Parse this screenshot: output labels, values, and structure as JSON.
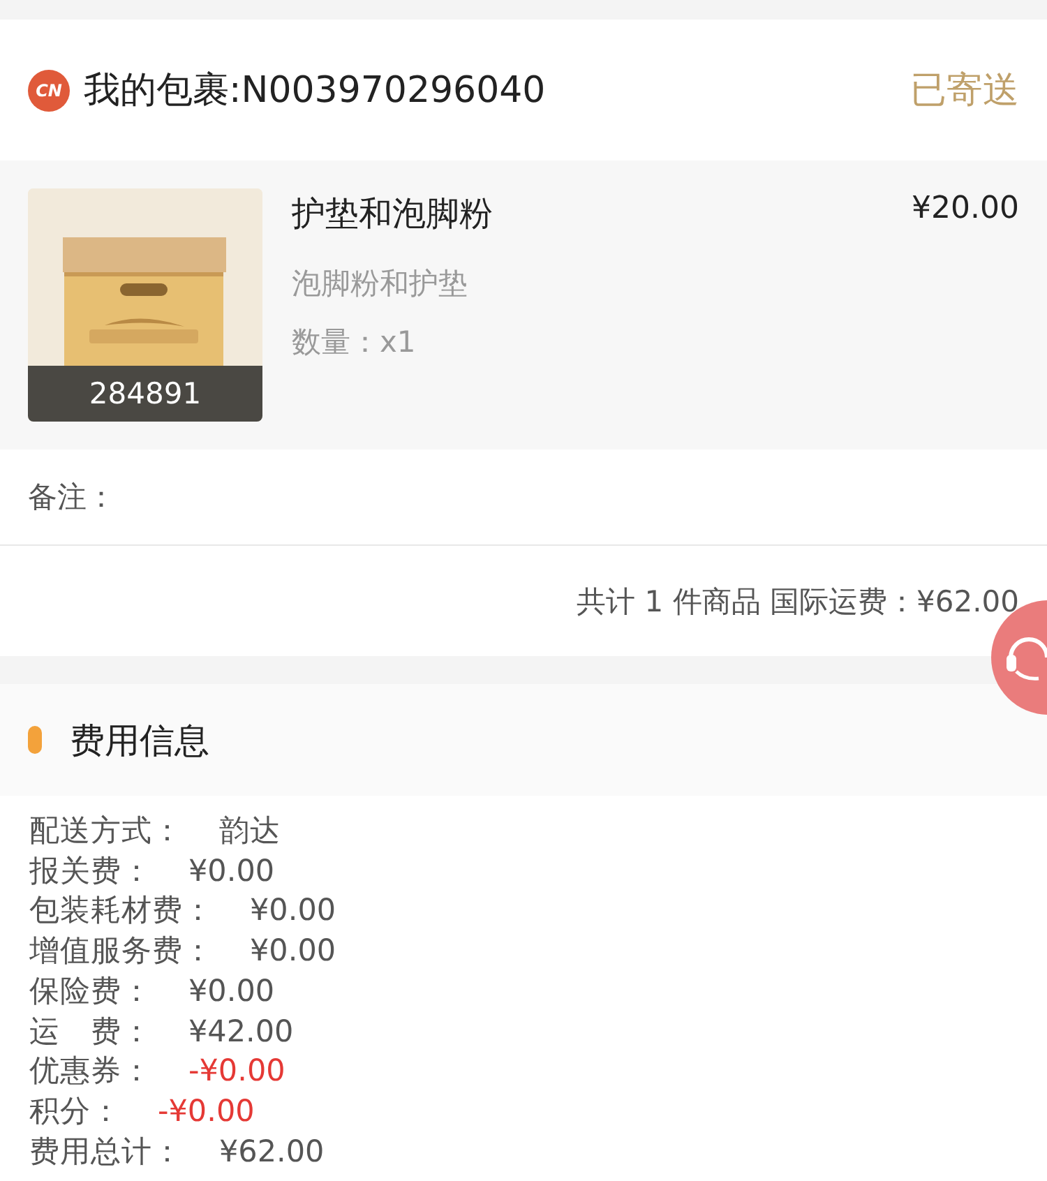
{
  "package": {
    "logo": "CN",
    "title": "我的包裹:N003970296040",
    "status": "已寄送"
  },
  "item": {
    "image": {
      "kind": "picture",
      "caption": "284891"
    },
    "name": "护垫和泡脚粉",
    "spec": "泡脚粉和护垫",
    "quantity_label": "数量：",
    "quantity": "x1",
    "price": "¥20.00"
  },
  "remark": {
    "label": "备注："
  },
  "summary": "共计 1 件商品 国际运费：¥62.00",
  "fees": {
    "title": "费用信息",
    "rows": [
      {
        "label": "配送方式：",
        "value": "韵达",
        "kind": "plain"
      },
      {
        "label": "报关费：",
        "value": "¥0.00",
        "kind": "plain"
      },
      {
        "label": "包装耗材费：",
        "value": "¥0.00",
        "kind": "plain"
      },
      {
        "label": "增值服务费：",
        "value": "¥0.00",
        "kind": "plain"
      },
      {
        "label": "保险费：",
        "value": "¥0.00",
        "kind": "plain"
      },
      {
        "label": "运　费：",
        "value": "¥42.00",
        "kind": "plain"
      },
      {
        "label": "优惠券：",
        "value": "-¥0.00",
        "kind": "deduction"
      },
      {
        "label": "积分：",
        "value": "-¥0.00",
        "kind": "deduction"
      },
      {
        "label": "费用总计：",
        "value": "¥62.00",
        "kind": "plain"
      }
    ]
  }
}
